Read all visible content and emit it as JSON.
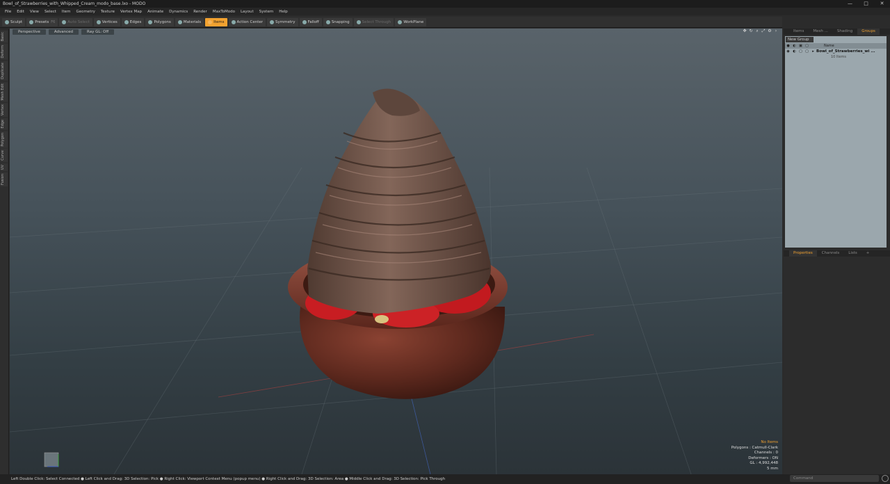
{
  "window": {
    "title": "Bowl_of_Strawberries_with_Whipped_Cream_modo_base.lxo - MODO",
    "minimize": "—",
    "maximize": "□",
    "close": "✕"
  },
  "menu": [
    "File",
    "Edit",
    "View",
    "Select",
    "Item",
    "Geometry",
    "Texture",
    "Vertex Map",
    "Animate",
    "Dynamics",
    "Render",
    "MaxToModo",
    "Layout",
    "System",
    "Help"
  ],
  "toolbar": {
    "sculpt": "Sculpt",
    "presets": "Presets",
    "presets_hint": "F6",
    "auto_select": "Auto Select",
    "vertices": "Vertices",
    "edges": "Edges",
    "polygons": "Polygons",
    "materials": "Materials",
    "items": "Items",
    "action_center": "Action Center",
    "symmetry": "Symmetry",
    "falloff": "Falloff",
    "snapping": "Snapping",
    "select_through": "Select Through",
    "workplane": "WorkPlane"
  },
  "left_tabs": [
    "Basic",
    "Deform",
    "Duplicate",
    "Mesh Edit",
    "Vertex",
    "Edge",
    "Polygon",
    "Curve",
    "UV",
    "Fusion"
  ],
  "viewport": {
    "view": "Perspective",
    "shading": "Advanced",
    "ray_gl": "Ray GL: Off",
    "stats": {
      "no_items": "No Items",
      "polygons": "Polygons : Catmull-Clark",
      "channels": "Channels : 0",
      "deformers": "Deformers : ON",
      "gl": "GL : 4,992,448",
      "units": "5 mm"
    }
  },
  "right_panel": {
    "tabs": [
      "Items",
      "Mesh ...",
      "Shading",
      "Groups"
    ],
    "active_tab": "Groups",
    "new_group": "New Group",
    "col_name": "Name",
    "group_name": "Bowl_of_Strawberries_wi ...",
    "group_sub": "10 Items",
    "prop_tabs": [
      "Properties",
      "Channels",
      "Lists"
    ],
    "prop_add": "+"
  },
  "status": {
    "hint": "Left Double Click: Select Connected ● Left Click and Drag: 3D Selection: Pick ● Right Click: Viewport Context Menu (popup menu) ● Right Click and Drag: 3D Selection: Area ● Middle Click and Drag: 3D Selection: Pick Through",
    "command_placeholder": "Command"
  },
  "colors": {
    "accent": "#f3a230",
    "cream": "#6e5347",
    "bowl": "#6b3024",
    "strawberry": "#c81d22"
  }
}
